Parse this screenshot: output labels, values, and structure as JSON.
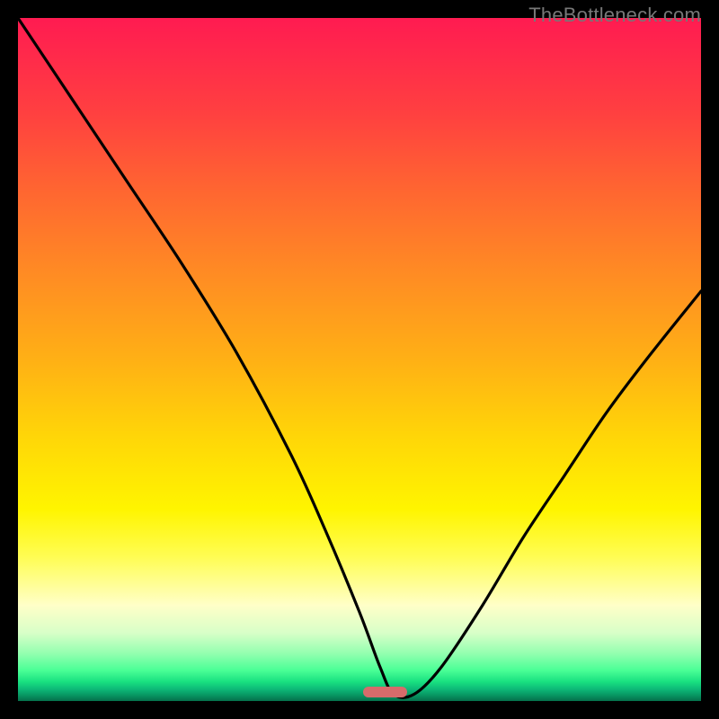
{
  "watermark": "TheBottleneck.com",
  "chart_data": {
    "type": "line",
    "title": "",
    "xlabel": "",
    "ylabel": "",
    "xlim": [
      0,
      100
    ],
    "ylim": [
      0,
      100
    ],
    "grid": false,
    "legend": false,
    "series": [
      {
        "name": "curve",
        "x": [
          0,
          8,
          16,
          24,
          32,
          40,
          45,
          50,
          53,
          55,
          58,
          62,
          68,
          74,
          80,
          86,
          92,
          100
        ],
        "values": [
          100,
          88,
          76,
          64,
          51,
          36,
          25,
          13,
          5,
          1,
          1,
          5,
          14,
          24,
          33,
          42,
          50,
          60
        ]
      }
    ],
    "marker": {
      "x_start": 50.5,
      "x_end": 57,
      "y": 0,
      "color": "#d76b6b"
    },
    "gradient_stops": [
      {
        "pct": 0,
        "color": "#ff1b51"
      },
      {
        "pct": 6,
        "color": "#ff2b4a"
      },
      {
        "pct": 14,
        "color": "#ff4040"
      },
      {
        "pct": 25,
        "color": "#ff6531"
      },
      {
        "pct": 37,
        "color": "#ff8a24"
      },
      {
        "pct": 50,
        "color": "#ffb015"
      },
      {
        "pct": 62,
        "color": "#ffd807"
      },
      {
        "pct": 72,
        "color": "#fff500"
      },
      {
        "pct": 79,
        "color": "#fffd55"
      },
      {
        "pct": 86,
        "color": "#ffffc8"
      },
      {
        "pct": 90,
        "color": "#d8ffc8"
      },
      {
        "pct": 93,
        "color": "#94ffb0"
      },
      {
        "pct": 95.5,
        "color": "#4aff96"
      },
      {
        "pct": 97.2,
        "color": "#18e080"
      },
      {
        "pct": 98.3,
        "color": "#0db877"
      },
      {
        "pct": 99.1,
        "color": "#089863"
      },
      {
        "pct": 100,
        "color": "#05704b"
      }
    ]
  }
}
